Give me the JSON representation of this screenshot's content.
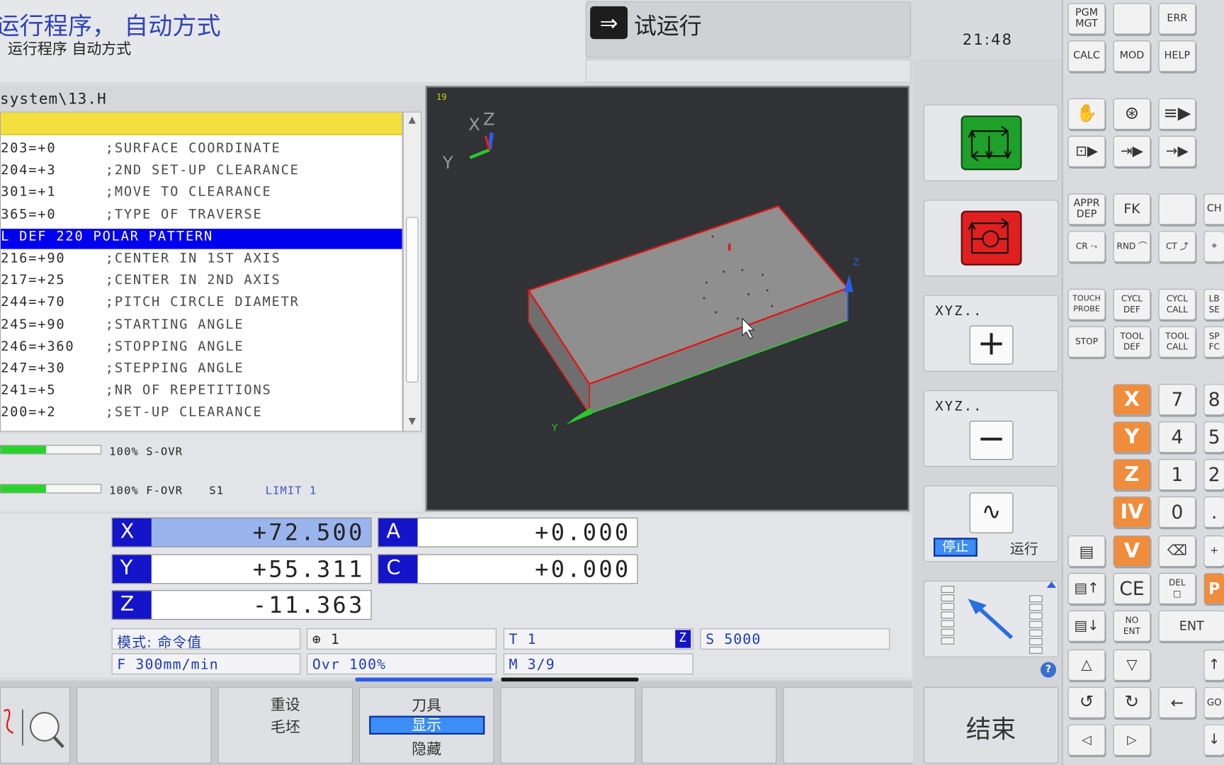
{
  "header": {
    "title": "运行程序， 自动方式",
    "subtitle": "运行程序  自动方式",
    "mode_label": "试运行",
    "clock": "21:48"
  },
  "program": {
    "path": "system\\13.H",
    "lines": [
      {
        "code": "203=+0",
        "comment": ";SURFACE COORDINATE"
      },
      {
        "code": "204=+3",
        "comment": ";2ND SET-UP CLEARANCE"
      },
      {
        "code": "301=+1",
        "comment": ";MOVE TO CLEARANCE"
      },
      {
        "code": "365=+0",
        "comment": ";TYPE OF TRAVERSE"
      },
      {
        "code": "L DEF 220 POLAR PATTERN",
        "comment": ""
      },
      {
        "code": "216=+90",
        "comment": ";CENTER IN 1ST AXIS"
      },
      {
        "code": "217=+25",
        "comment": ";CENTER IN 2ND AXIS"
      },
      {
        "code": "244=+70",
        "comment": ";PITCH CIRCLE DIAMETR"
      },
      {
        "code": "245=+90",
        "comment": ";STARTING ANGLE"
      },
      {
        "code": "246=+360",
        "comment": ";STOPPING ANGLE"
      },
      {
        "code": "247=+30",
        "comment": ";STEPPING ANGLE"
      },
      {
        "code": "241=+5",
        "comment": ";NR OF REPETITIONS"
      },
      {
        "code": "200=+2",
        "comment": ";SET-UP CLEARANCE"
      }
    ],
    "selected_index": 4
  },
  "overrides": {
    "s_ovr": {
      "percent": 100,
      "label": "100% S-OVR"
    },
    "f_ovr": {
      "percent": 100,
      "label": "100% F-OVR",
      "spindle": "S1",
      "limit": "LIMIT 1"
    }
  },
  "view3d": {
    "badge": "19",
    "triad": {
      "x": "X",
      "y": "Y",
      "z": "Z"
    },
    "part_axis_z": "Z",
    "part_axis_y": "Y"
  },
  "positions": {
    "X": "+72.500",
    "Y": "+55.311",
    "Z": "-11.363",
    "A": "+0.000",
    "C": "+0.000"
  },
  "status": {
    "mode": "模式: 命令值",
    "datum": "1",
    "tool": "T  1",
    "tool_axis": "Z",
    "spindle": "S  5000",
    "feed": "F  300mm/min",
    "ovr": "Ovr  100%",
    "m": "M  3/9"
  },
  "softkeys": {
    "reset_line1": "重设",
    "reset_line2": "毛坯",
    "tool_title": "刀具",
    "tool_show": "显示",
    "tool_hide": "隐藏",
    "end": "结束"
  },
  "right_keys": {
    "xyz_plus": "XYZ..",
    "xyz_minus": "XYZ..",
    "stop": "停止",
    "run": "运行"
  },
  "keyboard": {
    "row1": [
      "PGM\nMGT",
      "",
      "ERR"
    ],
    "row2": [
      "CALC",
      "MOD",
      "HELP"
    ],
    "prog_row1": [
      "APPR\nDEP",
      "FK",
      "",
      "CH"
    ],
    "prog_row2": [
      "CR",
      "RND",
      "CT",
      ""
    ],
    "cycle_row1": [
      "TOUCH\nPROBE",
      "CYCL\nDEF",
      "CYCL\nCALL",
      "LB\nSE"
    ],
    "cycle_row2": [
      "STOP",
      "TOOL\nDEF",
      "TOOL\nCALL",
      "SP\nFC"
    ],
    "axes": [
      "X",
      "Y",
      "Z",
      "IV",
      "V"
    ],
    "digits": [
      "7",
      "4",
      "1",
      "0"
    ],
    "digits_partial": [
      "8",
      "5",
      "2",
      "."
    ],
    "ce": "CE",
    "del": "DEL",
    "no_ent": "NO\nENT",
    "ent": "ENT",
    "goto": "GO"
  }
}
